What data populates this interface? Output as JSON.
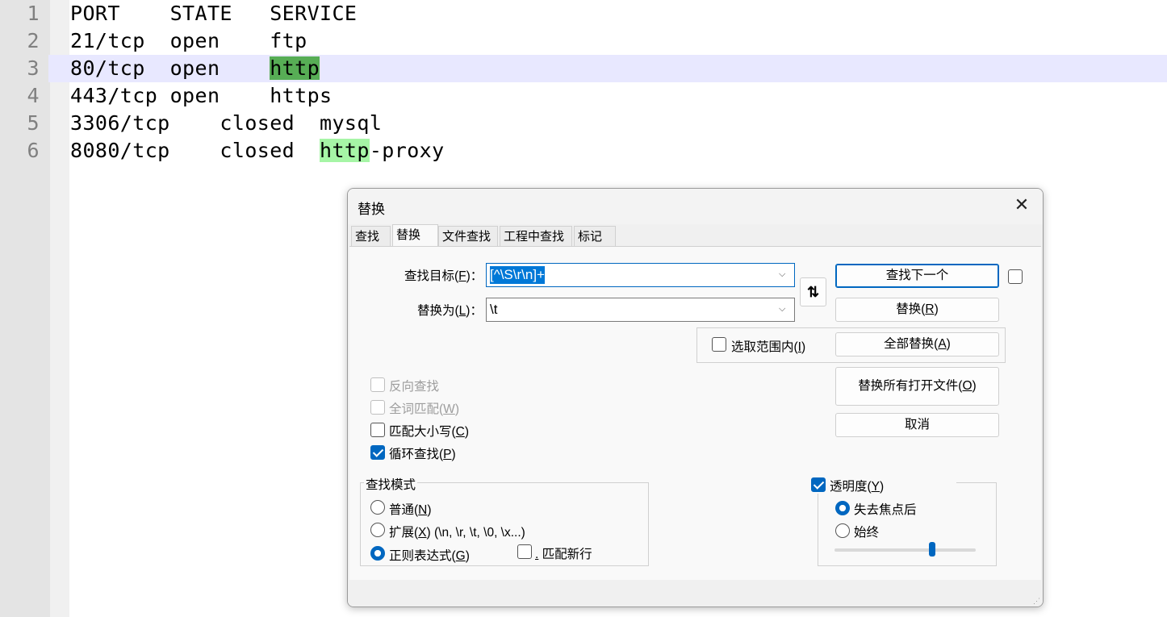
{
  "editor": {
    "lines": [
      {
        "num": "1",
        "text": "PORT    STATE   SERVICE"
      },
      {
        "num": "2",
        "pre": "21/tcp  open    ",
        "text": "ftp"
      },
      {
        "num": "3",
        "pre": "80/tcp  open    ",
        "hl": "http",
        "post": ""
      },
      {
        "num": "4",
        "pre": "443/tcp open    ",
        "text": "https"
      },
      {
        "num": "5",
        "pre": "3306/tcp    closed  ",
        "text": "mysql"
      },
      {
        "num": "6",
        "pre": "8080/tcp    closed  ",
        "hl": "http",
        "post": "-proxy"
      }
    ],
    "current_line": 3,
    "colors": {
      "strong_highlight": "#57ad55",
      "soft_highlight": "#a6f5a6",
      "current_line": "#e8e8ff"
    }
  },
  "dialog": {
    "title": "替换",
    "close_icon": "close-icon",
    "tabs": [
      {
        "label": "查找"
      },
      {
        "label": "替换"
      },
      {
        "label": "文件查找"
      },
      {
        "label": "工程中查找"
      },
      {
        "label": "标记"
      }
    ],
    "active_tab": "替换",
    "find": {
      "label_a": "查找目标(",
      "key": "F",
      "label_b": ")：",
      "value": "[^\\S\\r\\n]+"
    },
    "replace": {
      "label_a": "替换为(",
      "key": "L",
      "label_b": ")：",
      "value": "\\t"
    },
    "swap_icon": "swap-icon",
    "in_selection": {
      "label_a": "选取范围内(",
      "key": "I",
      "label_b": ")",
      "checked": false
    },
    "buttons": {
      "find_next": "查找下一个",
      "replace_a": "替换(",
      "replace_key": "R",
      "replace_b": ")",
      "replace_all_a": "全部替换(",
      "replace_all_key": "A",
      "replace_all_b": ")",
      "replace_open_a": "替换所有打开文件(",
      "replace_open_key": "O",
      "replace_open_b": ")",
      "cancel": "取消"
    },
    "options": {
      "backward": {
        "label": "反向查找",
        "checked": false,
        "enabled": false
      },
      "whole_word": {
        "label_a": "全词匹配(",
        "key": "W",
        "label_b": ")",
        "checked": false,
        "enabled": false
      },
      "match_case": {
        "label_a": "匹配大小写(",
        "key": "C",
        "label_b": ")",
        "checked": false
      },
      "wrap": {
        "label_a": "循环查找(",
        "key": "P",
        "label_b": ")",
        "checked": true
      }
    },
    "search_mode": {
      "title": "查找模式",
      "normal": {
        "label_a": "普通(",
        "key": "N",
        "label_b": ")",
        "checked": false
      },
      "extended": {
        "label_a": "扩展(",
        "key": "X",
        "label_b": ") (\\n, \\r, \\t, \\0, \\x...)",
        "checked": false
      },
      "regex": {
        "label_a": "正则表达式(",
        "key": "G",
        "label_b": ")",
        "checked": true
      },
      "dot_newline": {
        "dot": ".",
        "label": " 匹配新行",
        "checked": false
      }
    },
    "transparency": {
      "label_a": "透明度(",
      "key": "Y",
      "label_b": ")",
      "checked": true,
      "on_lose_focus": {
        "label": "失去焦点后",
        "checked": true
      },
      "always": {
        "label": "始终",
        "checked": false
      },
      "slider_value": 0.7
    },
    "accent": "#0067c0"
  }
}
